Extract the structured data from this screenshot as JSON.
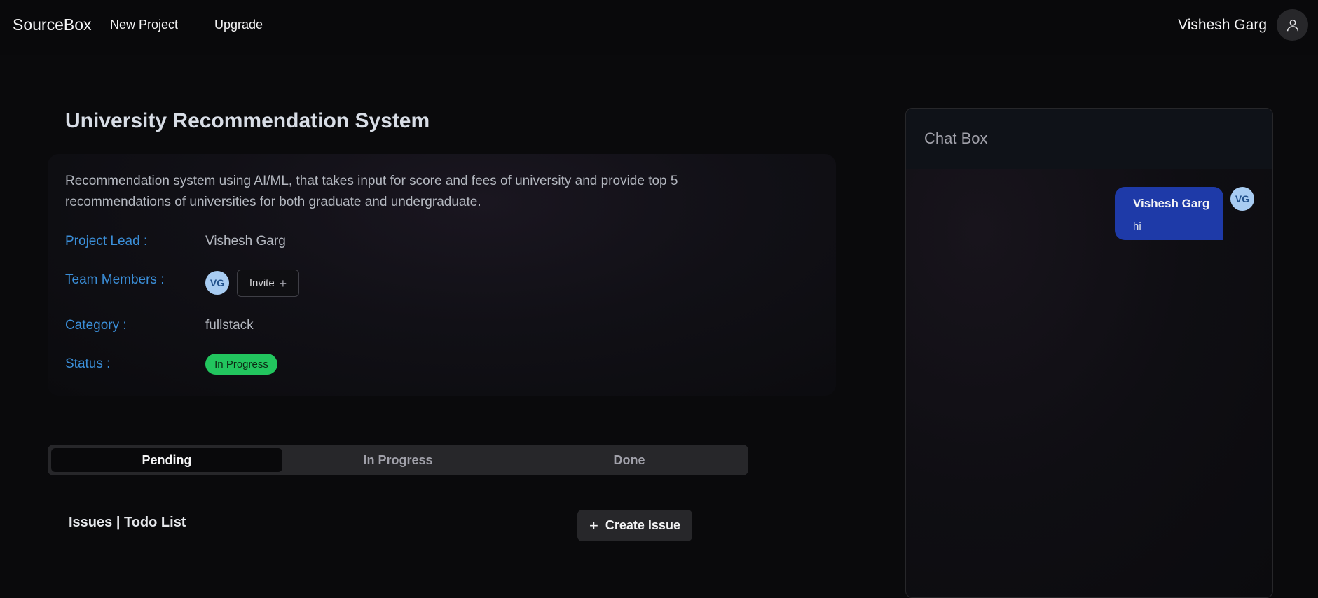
{
  "nav": {
    "brand": "SourceBox",
    "new_project": "New Project",
    "upgrade": "Upgrade",
    "user_name": "Vishesh Garg",
    "avatar_icon": "user-icon"
  },
  "project": {
    "title": "University Recommendation System",
    "description": "Recommendation system using AI/ML, that takes input for score and fees of university and provide top 5 recommendations of universities for both graduate and undergraduate.",
    "lead_label": "Project Lead :",
    "lead_value": "Vishesh Garg",
    "team_label": "Team Members :",
    "member_initials": "VG",
    "invite_label": "Invite",
    "category_label": "Category :",
    "category_value": "fullstack",
    "status_label": "Status :",
    "status_value": "In Progress",
    "status_color": "#22c55e",
    "label_color": "#3b8fd9"
  },
  "tabs": [
    {
      "label": "Pending",
      "active": true
    },
    {
      "label": "In Progress",
      "active": false
    },
    {
      "label": "Done",
      "active": false
    }
  ],
  "issues": {
    "title": "Issues | Todo List",
    "create_label": "Create Issue"
  },
  "chat": {
    "title": "Chat Box",
    "messages": [
      {
        "sender": "Vishesh Garg",
        "text": "hi",
        "initials": "VG"
      }
    ],
    "bubble_color": "#1e3aa8"
  }
}
